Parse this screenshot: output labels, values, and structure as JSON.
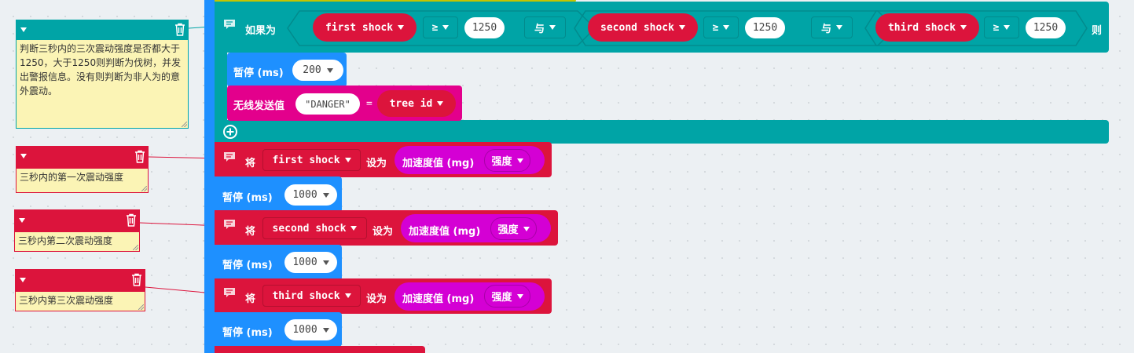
{
  "colors": {
    "logic": "#00a4a6",
    "variable": "#dc143c",
    "basic": "#1e90ff",
    "radio": "#e3008c",
    "input": "#d400d4",
    "comment_yellow": "#fbf4b5"
  },
  "comments": [
    {
      "text": "判断三秒内的三次震动强度是否都大于1250，大于1250则判断为伐树，并发出警报信息。没有则判断为非人为的意外震动。",
      "icon": "trash-icon"
    },
    {
      "text": "三秒内的第一次震动强度",
      "icon": "trash-icon"
    },
    {
      "text": "三秒内第二次震动强度",
      "icon": "trash-icon"
    },
    {
      "text": "三秒内第三次震动强度",
      "icon": "trash-icon"
    }
  ],
  "if_block": {
    "label": "如果为",
    "then": "则",
    "conditions": [
      {
        "var": "first shock",
        "op": "≥",
        "value": "1250"
      },
      {
        "var": "second shock",
        "op": "≥",
        "value": "1250"
      },
      {
        "var": "third shock",
        "op": "≥",
        "value": "1250"
      }
    ],
    "joiners": [
      "与",
      "与"
    ],
    "body": {
      "pause_label": "暂停 (ms)",
      "pause_value": "200",
      "radio_label": "无线发送值",
      "radio_string": "DANGER",
      "radio_eq": "=",
      "radio_var": "tree id"
    }
  },
  "sets": [
    {
      "set": "将",
      "var": "first shock",
      "to": "设为",
      "reading": "加速度值 (mg)",
      "axis": "强度",
      "pause_label": "暂停 (ms)",
      "pause_value": "1000"
    },
    {
      "set": "将",
      "var": "second shock",
      "to": "设为",
      "reading": "加速度值 (mg)",
      "axis": "强度",
      "pause_label": "暂停 (ms)",
      "pause_value": "1000"
    },
    {
      "set": "将",
      "var": "third shock",
      "to": "设为",
      "reading": "加速度值 (mg)",
      "axis": "强度",
      "pause_label": "暂停 (ms)",
      "pause_value": "1000"
    }
  ]
}
